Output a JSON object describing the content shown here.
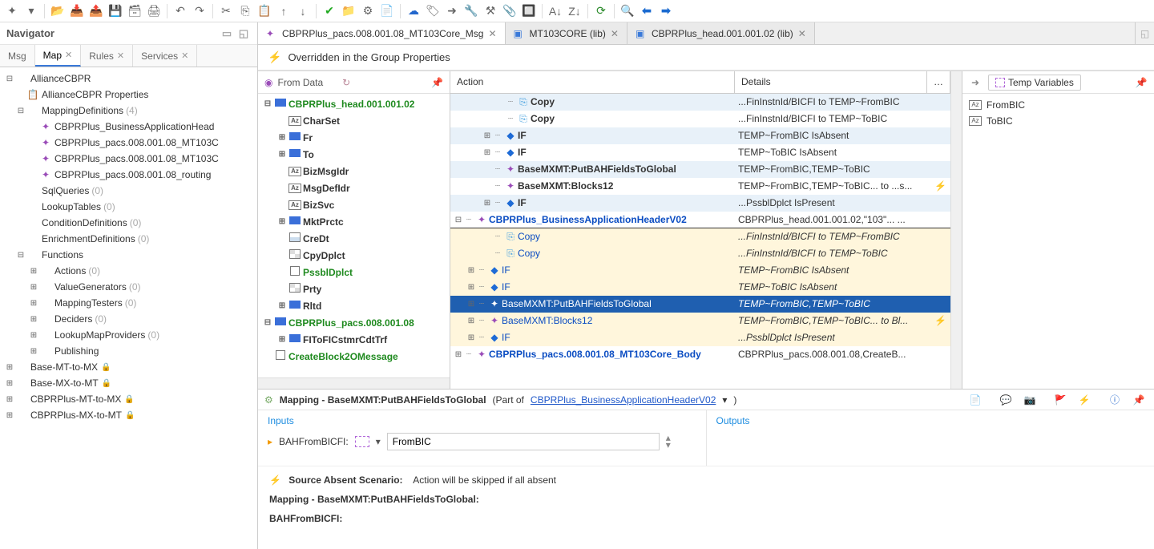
{
  "navigator": {
    "title": "Navigator",
    "tabs": [
      {
        "label": "Msg",
        "active": false,
        "closable": false
      },
      {
        "label": "Map",
        "active": true,
        "closable": true
      },
      {
        "label": "Rules",
        "active": false,
        "closable": true
      },
      {
        "label": "Services",
        "active": false,
        "closable": true
      }
    ],
    "tree": [
      {
        "label": "AllianceCBPR",
        "level": 0,
        "exp": "⊟"
      },
      {
        "label": "AllianceCBPR Properties",
        "level": 1,
        "icon": "props"
      },
      {
        "label": "MappingDefinitions",
        "count": "(4)",
        "level": 1,
        "exp": "⊟"
      },
      {
        "label": "CBPRPlus_BusinessApplicationHead",
        "level": 2,
        "icon": "map"
      },
      {
        "label": "CBPRPlus_pacs.008.001.08_MT103C",
        "level": 2,
        "icon": "map"
      },
      {
        "label": "CBPRPlus_pacs.008.001.08_MT103C",
        "level": 2,
        "icon": "map"
      },
      {
        "label": "CBPRPlus_pacs.008.001.08_routing",
        "level": 2,
        "icon": "map"
      },
      {
        "label": "SqlQueries",
        "count": "(0)",
        "level": 1
      },
      {
        "label": "LookupTables",
        "count": "(0)",
        "level": 1
      },
      {
        "label": "ConditionDefinitions",
        "count": "(0)",
        "level": 1
      },
      {
        "label": "EnrichmentDefinitions",
        "count": "(0)",
        "level": 1
      },
      {
        "label": "Functions",
        "level": 1,
        "exp": "⊟"
      },
      {
        "label": "Actions",
        "count": "(0)",
        "level": 2,
        "exp": "⊞"
      },
      {
        "label": "ValueGenerators",
        "count": "(0)",
        "level": 2,
        "exp": "⊞"
      },
      {
        "label": "MappingTesters",
        "count": "(0)",
        "level": 2,
        "exp": "⊞"
      },
      {
        "label": "Deciders",
        "count": "(0)",
        "level": 2,
        "exp": "⊞"
      },
      {
        "label": "LookupMapProviders",
        "count": "(0)",
        "level": 2,
        "exp": "⊞"
      },
      {
        "label": "Publishing",
        "level": 2,
        "exp": "⊞"
      },
      {
        "label": "Base-MT-to-MX",
        "level": 0,
        "exp": "⊞",
        "lock": true
      },
      {
        "label": "Base-MX-to-MT",
        "level": 0,
        "exp": "⊞",
        "lock": true
      },
      {
        "label": "CBPRPlus-MT-to-MX",
        "level": 0,
        "exp": "⊞",
        "lock": true
      },
      {
        "label": "CBPRPlus-MX-to-MT",
        "level": 0,
        "exp": "⊞",
        "lock": true
      }
    ]
  },
  "editor": {
    "tabs": [
      {
        "label": "CBPRPlus_pacs.008.001.08_MT103Core_Msg",
        "active": true,
        "icon": "map"
      },
      {
        "label": "MT103CORE (lib)",
        "active": false,
        "icon": "msg"
      },
      {
        "label": "CBPRPlus_head.001.001.02 (lib)",
        "active": false,
        "icon": "msg"
      }
    ],
    "override_label": "Overridden in the Group Properties"
  },
  "fromdata": {
    "title": "From Data",
    "items": [
      {
        "label": "CBPRPlus_head.001.001.02",
        "cls": "fd-green",
        "exp": "⊟",
        "icon": "blue",
        "level": 0
      },
      {
        "label": "CharSet",
        "cls": "norm",
        "icon": "az",
        "level": 1
      },
      {
        "label": "Fr",
        "cls": "norm",
        "exp": "⊞",
        "icon": "blue",
        "level": 1
      },
      {
        "label": "To",
        "cls": "norm",
        "exp": "⊞",
        "icon": "blue",
        "level": 1
      },
      {
        "label": "BizMsgIdr",
        "cls": "norm",
        "icon": "az",
        "level": 1
      },
      {
        "label": "MsgDefIdr",
        "cls": "norm",
        "icon": "az",
        "level": 1
      },
      {
        "label": "BizSvc",
        "cls": "norm",
        "icon": "az",
        "level": 1
      },
      {
        "label": "MktPrctc",
        "cls": "norm",
        "exp": "⊞",
        "icon": "blue",
        "level": 1
      },
      {
        "label": "CreDt",
        "cls": "norm",
        "icon": "cal",
        "level": 1
      },
      {
        "label": "CpyDplct",
        "cls": "norm",
        "icon": "grid",
        "level": 1
      },
      {
        "label": "PssblDplct",
        "cls": "fd-green",
        "icon": "box",
        "level": 1
      },
      {
        "label": "Prty",
        "cls": "norm",
        "icon": "grid",
        "level": 1
      },
      {
        "label": "Rltd",
        "cls": "norm",
        "exp": "⊞",
        "icon": "blue",
        "level": 1
      },
      {
        "label": "CBPRPlus_pacs.008.001.08",
        "cls": "fd-green",
        "exp": "⊟",
        "icon": "blue",
        "level": 0
      },
      {
        "label": "FIToFICstmrCdtTrf",
        "cls": "norm",
        "exp": "⊞",
        "icon": "blue",
        "level": 1
      },
      {
        "label": "CreateBlock2OMessage",
        "cls": "fd-green",
        "icon": "box",
        "level": 0
      }
    ]
  },
  "action_table": {
    "hdr_action": "Action",
    "hdr_details": "Details",
    "rows": [
      {
        "pad": 3,
        "exp": "",
        "icon": "copy",
        "label": "Copy",
        "lcls": "alabel",
        "details": "...FinInstnId/BICFI to TEMP~FromBIC",
        "style": "hi1"
      },
      {
        "pad": 3,
        "exp": "",
        "icon": "copy",
        "label": "Copy",
        "lcls": "alabel",
        "details": "...FinInstnId/BICFI to TEMP~ToBIC",
        "style": ""
      },
      {
        "pad": 2,
        "exp": "⊞",
        "icon": "dia",
        "label": "IF",
        "lcls": "alabel",
        "details": "TEMP~FromBIC IsAbsent",
        "style": "hi1"
      },
      {
        "pad": 2,
        "exp": "⊞",
        "icon": "dia",
        "label": "IF",
        "lcls": "alabel",
        "details": "TEMP~ToBIC IsAbsent",
        "style": ""
      },
      {
        "pad": 2,
        "exp": "",
        "icon": "gear",
        "label": "BaseMXMT:PutBAHFieldsToGlobal",
        "lcls": "alabel",
        "details": "TEMP~FromBIC,TEMP~ToBIC",
        "style": "hi1"
      },
      {
        "pad": 2,
        "exp": "",
        "icon": "gear",
        "label": "BaseMXMT:Blocks12",
        "lcls": "alabel",
        "details": "TEMP~FromBIC,TEMP~ToBIC... to ...s...",
        "style": "",
        "bolt": true
      },
      {
        "pad": 2,
        "exp": "⊞",
        "icon": "dia",
        "label": "IF",
        "lcls": "alabel",
        "details": "...PssblDplct IsPresent",
        "style": "hi1"
      },
      {
        "pad": 0,
        "exp": "⊟",
        "icon": "mapg",
        "label": "CBPRPlus_BusinessApplicationHeaderV02",
        "lcls": "bluebold",
        "details": "CBPRPlus_head.001.001.02,\"103\"... ...",
        "style": "underline-row",
        "dblue": true
      },
      {
        "pad": 2,
        "exp": "",
        "icon": "copy",
        "label": "Copy",
        "lcls": "blue",
        "details": "...FinInstnId/BICFI to TEMP~FromBIC",
        "style": "hi2 italic"
      },
      {
        "pad": 2,
        "exp": "",
        "icon": "copy",
        "label": "Copy",
        "lcls": "blue",
        "details": "...FinInstnId/BICFI to TEMP~ToBIC",
        "style": "hi2 italic"
      },
      {
        "pad": 1,
        "exp": "⊞",
        "icon": "dia",
        "label": "IF",
        "lcls": "blue",
        "details": "TEMP~FromBIC IsAbsent",
        "style": "hi2 italic"
      },
      {
        "pad": 1,
        "exp": "⊞",
        "icon": "dia",
        "label": "IF",
        "lcls": "blue",
        "details": "TEMP~ToBIC IsAbsent",
        "style": "hi2 italic"
      },
      {
        "pad": 1,
        "exp": "⊞",
        "icon": "gear",
        "label": "BaseMXMT:PutBAHFieldsToGlobal",
        "lcls": "blue",
        "details": "TEMP~FromBIC,TEMP~ToBIC",
        "style": "sel italic"
      },
      {
        "pad": 1,
        "exp": "⊞",
        "icon": "gear",
        "label": "BaseMXMT:Blocks12",
        "lcls": "blue",
        "details": "TEMP~FromBIC,TEMP~ToBIC... to Bl...",
        "style": "hi2 italic",
        "bolt": true
      },
      {
        "pad": 1,
        "exp": "⊞",
        "icon": "dia",
        "label": "IF",
        "lcls": "blue",
        "details": "...PssblDplct IsPresent",
        "style": "hi2 italic"
      },
      {
        "pad": 0,
        "exp": "⊞",
        "icon": "mapg",
        "label": "CBPRPlus_pacs.008.001.08_MT103Core_Body",
        "lcls": "bluebold",
        "details": "CBPRPlus_pacs.008.001.08,CreateB...",
        "style": "",
        "dblue": true
      }
    ]
  },
  "mapping_detail": {
    "header_pre": "Mapping  -  BaseMXMT:PutBAHFieldsToGlobal",
    "header_mid": "(Part of ",
    "header_link": "CBPRPlus_BusinessApplicationHeaderV02",
    "header_post": ")",
    "inputs_label": "Inputs",
    "outputs_label": "Outputs",
    "input_name": "BAHFromBICFI:",
    "input_value": "FromBIC",
    "scenario_label": "Source Absent Scenario:",
    "scenario_text": "Action will be skipped if all absent",
    "mapping_line": "Mapping  -  BaseMXMT:PutBAHFieldsToGlobal:",
    "field_line": "BAHFromBICFI:"
  },
  "temp_vars": {
    "title": "Temp Variables",
    "items": [
      "FromBIC",
      "ToBIC"
    ]
  }
}
